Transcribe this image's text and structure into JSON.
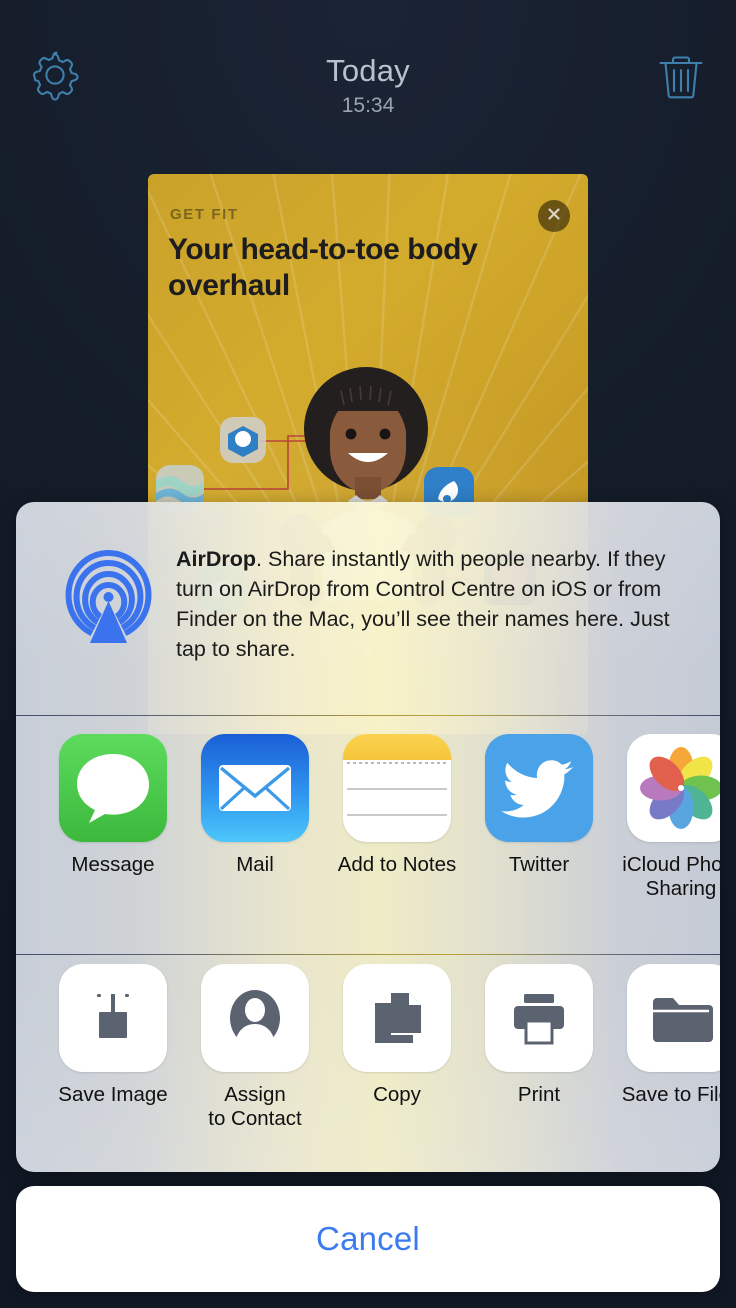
{
  "statusbar": {
    "title": "Today",
    "time": "15:34",
    "settings_icon": "gear-icon",
    "delete_icon": "trash-icon"
  },
  "card": {
    "eyebrow": "GET FIT",
    "headline": "Your head-to-toe body overhaul",
    "close_icon": "close-x-icon",
    "background_color": "#caa22a",
    "headline_color": "#1d1d1f"
  },
  "sheet": {
    "airdrop": {
      "icon": "airdrop-icon",
      "title": "AirDrop",
      "body": ". Share instantly with people nearby. If they turn on AirDrop from Control Centre on iOS or from Finder on the Mac, you’ll see their names here. Just tap to share.",
      "accent_color": "#3b7bf0"
    },
    "apps": [
      {
        "label": "Message",
        "icon": "messages-icon",
        "color": "#3cb93c"
      },
      {
        "label": "Mail",
        "icon": "mail-icon",
        "color": "#2f95ef"
      },
      {
        "label": "Add to Notes",
        "icon": "notes-icon",
        "color": "#f5c53a"
      },
      {
        "label": "Twitter",
        "icon": "twitter-icon",
        "color": "#4aa3e8"
      },
      {
        "label": "iCloud Photo\nSharing",
        "icon": "photos-icon",
        "color": "#ffffff"
      }
    ],
    "actions": [
      {
        "label": "Save Image",
        "icon": "save-image-icon"
      },
      {
        "label": "Assign\nto Contact",
        "icon": "contact-person-icon"
      },
      {
        "label": "Copy",
        "icon": "copy-documents-icon"
      },
      {
        "label": "Print",
        "icon": "printer-icon"
      },
      {
        "label": "Save to Files",
        "icon": "folder-icon"
      }
    ],
    "action_glyph_color": "#5c6370"
  },
  "cancel": {
    "label": "Cancel",
    "color": "#3b7bf0"
  }
}
